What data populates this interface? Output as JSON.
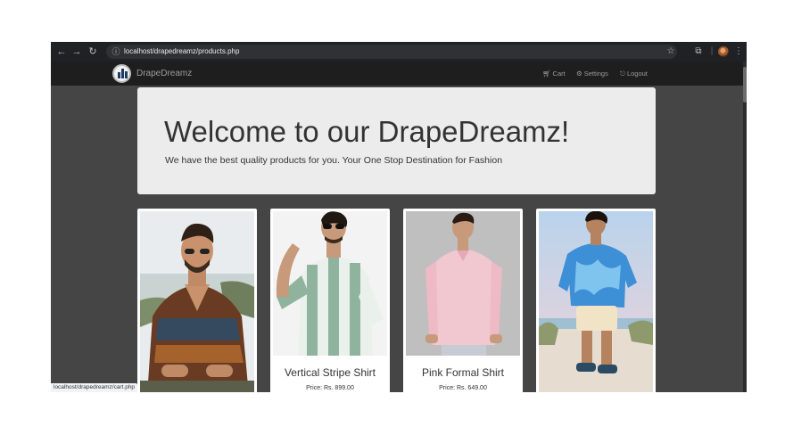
{
  "browser": {
    "url": "localhost/drapedreamz/products.php",
    "status_url": "localhost/drapedreamz/cart.php"
  },
  "navbar": {
    "brand": "DrapeDreamz",
    "links": [
      {
        "label": "Cart",
        "icon": "cart-icon"
      },
      {
        "label": "Settings",
        "icon": "gear-icon"
      },
      {
        "label": "Logout",
        "icon": "logout-icon"
      }
    ]
  },
  "hero": {
    "title": "Welcome to our DrapeDreamz!",
    "subtitle": "We have the best quality products for you. Your One Stop Destination for Fashion"
  },
  "products": [
    {
      "name": "",
      "price": ""
    },
    {
      "name": "Vertical Stripe Shirt",
      "price": "Price: Rs. 899.00"
    },
    {
      "name": "Pink Formal Shirt",
      "price": "Price: Rs. 649.00"
    },
    {
      "name": "",
      "price": ""
    }
  ],
  "colors": {
    "page_bg": "#454545",
    "navbar_bg": "#1e1e1e",
    "jumbotron_bg": "#ececec",
    "card_bg": "#ffffff",
    "chrome_bg": "#202124"
  }
}
